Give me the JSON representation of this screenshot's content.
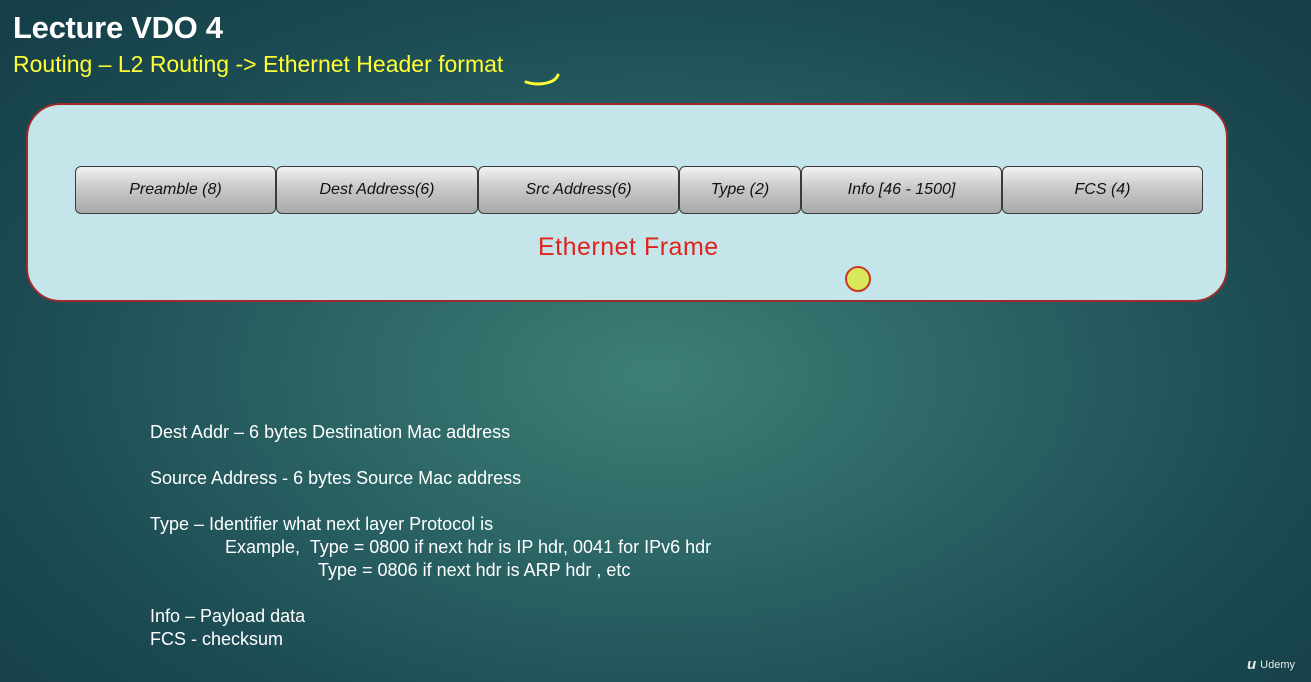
{
  "header": {
    "title": "Lecture VDO 4",
    "subtitle": "Routing – L2 Routing -> Ethernet Header format"
  },
  "frame": {
    "fields": [
      "Preamble (8)",
      "Dest Address(6)",
      "Src Address(6)",
      "Type (2)",
      "Info [46 - 1500]",
      "FCS (4)"
    ],
    "label": "Ethernet Frame"
  },
  "notes": {
    "dest": "Dest Addr – 6 bytes Destination Mac address",
    "source": "Source Address - 6 bytes Source Mac address",
    "type": "Type – Identifier what next layer Protocol is",
    "example1": "Example,  Type = 0800 if next hdr is IP hdr, 0041 for IPv6 hdr",
    "example2": "Type = 0806 if next hdr is ARP hdr , etc",
    "info": "Info – Payload data",
    "fcs": "FCS - checksum"
  },
  "watermark": {
    "brand": "Udemy"
  },
  "colors": {
    "title": "#ffffff",
    "subtitle": "#ffff33",
    "frame_label": "#e0231c",
    "frame_bg": "#c4e5ea",
    "frame_border": "#9e2a2a"
  }
}
